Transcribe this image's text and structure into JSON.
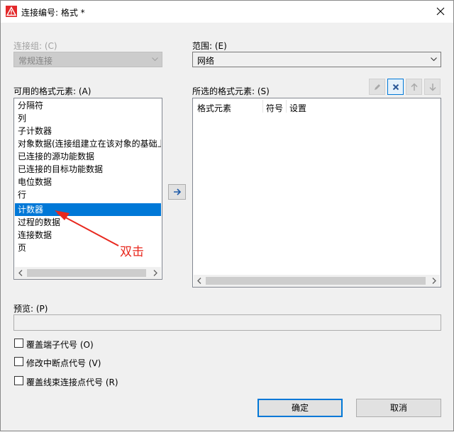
{
  "window": {
    "title": "连接编号: 格式 *"
  },
  "left": {
    "group_label": "连接组: (C)",
    "group_value": "常规连接",
    "available_label": "可用的格式元素: (A)",
    "items": [
      "分隔符",
      "列",
      "子计数器",
      "对象数据(连接组建立在该对象的基础上)",
      "已连接的源功能数据",
      "已连接的目标功能数据",
      "电位数据",
      "行",
      "计数器",
      "过程的数据",
      "连接数据",
      "页"
    ],
    "selected_item": "计数器"
  },
  "right": {
    "range_label": "范围: (E)",
    "range_value": "网络",
    "selected_label": "所选的格式元素: (S)",
    "columns": [
      "格式元素",
      "符号",
      "设置"
    ]
  },
  "preview": {
    "label": "预览: (P)"
  },
  "checkboxes": [
    "覆盖端子代号 (O)",
    "修改中断点代号 (V)",
    "覆盖线束连接点代号 (R)"
  ],
  "buttons": {
    "ok": "确定",
    "cancel": "取消"
  },
  "annotation": {
    "text": "双击"
  },
  "colors": {
    "accent": "#0078d7",
    "annotation": "#e8281e",
    "app_icon": "#e3292b"
  }
}
